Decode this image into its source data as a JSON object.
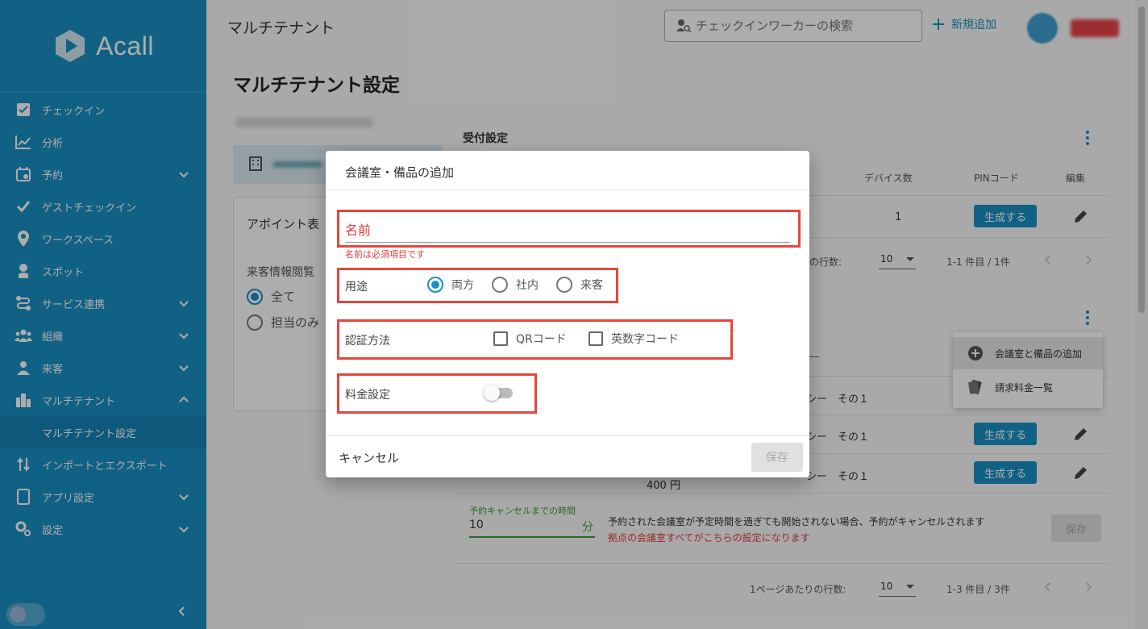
{
  "app": {
    "logo_text": "Acall"
  },
  "sidebar": {
    "items": [
      {
        "label": "チェックイン"
      },
      {
        "label": "分析"
      },
      {
        "label": "予約"
      },
      {
        "label": "ゲストチェックイン"
      },
      {
        "label": "ワークスペース"
      },
      {
        "label": "スポット"
      },
      {
        "label": "サービス連携"
      },
      {
        "label": "組織"
      },
      {
        "label": "来客"
      },
      {
        "label": "マルチテナント"
      },
      {
        "label": "マルチテナント設定"
      },
      {
        "label": "インポートとエクスポート"
      },
      {
        "label": "アプリ設定"
      },
      {
        "label": "設定"
      }
    ]
  },
  "header": {
    "title": "マルチテナント",
    "search_placeholder": "チェックインワーカーの検索",
    "new_add_label": "新規追加"
  },
  "page": {
    "title": "マルチテナント設定"
  },
  "background": {
    "appoint_title": "アポイント表",
    "visitor_info": "来客情報閲覧",
    "radio_all": "全て",
    "radio_only": "担当のみ",
    "reception_title": "受付設定",
    "col_devices": "デバイス数",
    "col_pin": "PINコード",
    "col_edit": "編集",
    "device_count": "1",
    "generate_label": "生成する",
    "rows_per_page": "の行数:",
    "rows_value": "10",
    "range_1": "1-1 件目 / 1件",
    "policy_1": "シー　その１",
    "policy_2": "シー　その１",
    "policy_3": "シー　その１",
    "price": "400 円",
    "cancel_time_label": "予約キャンセルまでの時間",
    "cancel_time_value": "10",
    "cancel_time_unit": "分",
    "note": "予約された会議室が予定時間を過ぎても開始されない場合、予約がキャンセルされます",
    "note_red": "拠点の会議室すべてがこちらの設定になります",
    "save_label": "保存",
    "rows_per_page_2": "1ページあたりの行数:",
    "rows_value_2": "10",
    "range_2": "1-3 件目 / 3件"
  },
  "menu": {
    "items": [
      {
        "label": "会議室と備品の追加"
      },
      {
        "label": "請求料金一覧"
      }
    ]
  },
  "dialog": {
    "title": "会議室・備品の追加",
    "name_placeholder": "名前",
    "name_error": "名前は必須項目です",
    "usage_label": "用途",
    "usage_options": [
      "両方",
      "社内",
      "来客"
    ],
    "auth_label": "認証方法",
    "auth_options": [
      "QRコード",
      "英数字コード"
    ],
    "fee_label": "料金設定",
    "cancel_label": "キャンセル",
    "save_label": "保存"
  },
  "colors": {
    "sidebar": "#1a8fc4",
    "highlight": "#e8453c",
    "error": "#e23b3b"
  }
}
